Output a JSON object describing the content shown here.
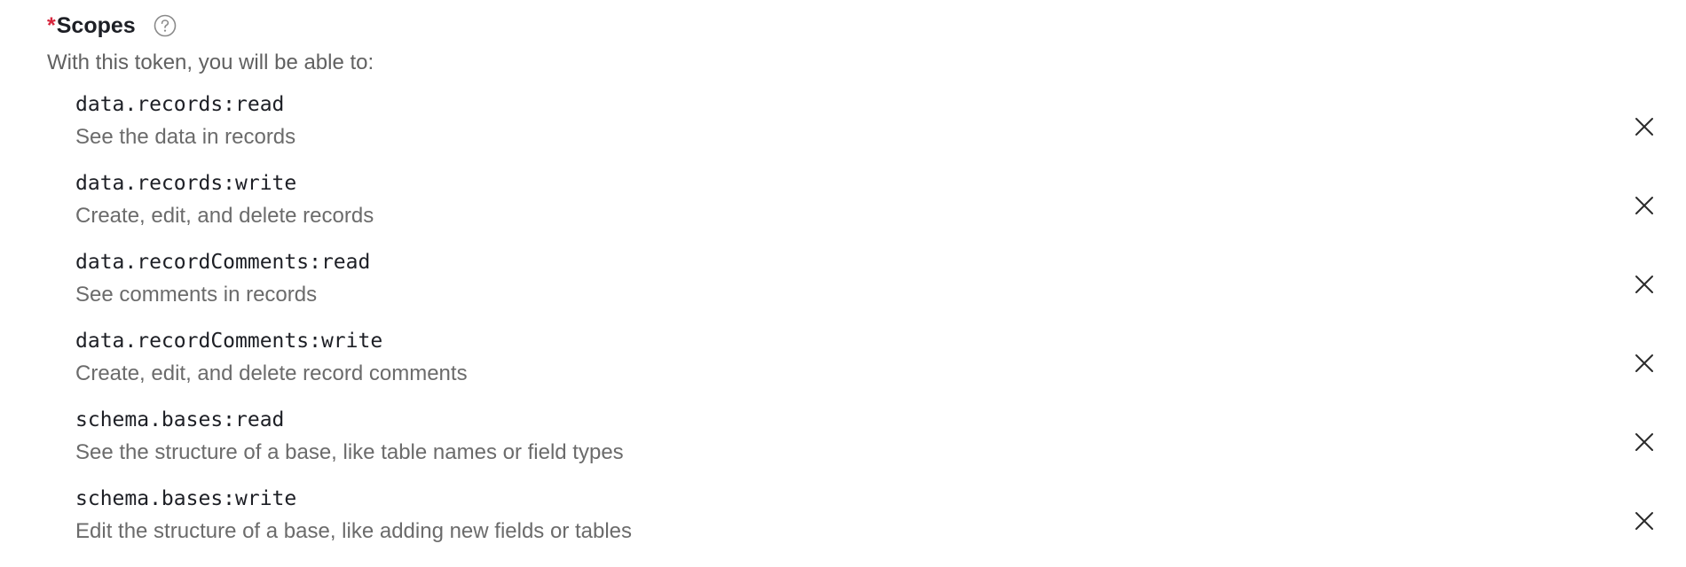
{
  "section": {
    "required_marker": "*",
    "title": "Scopes",
    "help_icon": "question-circle-icon",
    "subtitle": "With this token, you will be able to:"
  },
  "scopes": [
    {
      "name": "data.records:read",
      "description": "See the data in records"
    },
    {
      "name": "data.records:write",
      "description": "Create, edit, and delete records"
    },
    {
      "name": "data.recordComments:read",
      "description": "See comments in records"
    },
    {
      "name": "data.recordComments:write",
      "description": "Create, edit, and delete record comments"
    },
    {
      "name": "schema.bases:read",
      "description": "See the structure of a base, like table names or field types"
    },
    {
      "name": "schema.bases:write",
      "description": "Edit the structure of a base, like adding new fields or tables"
    }
  ],
  "colors": {
    "required": "#d7263d",
    "text": "#1d1f25",
    "muted": "#6b6b6b",
    "icon": "#8a8a8a"
  }
}
